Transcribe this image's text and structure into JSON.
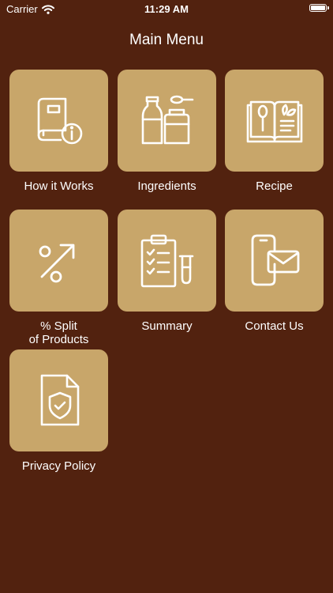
{
  "status_bar": {
    "carrier": "Carrier",
    "time": "11:29 AM"
  },
  "header": {
    "title": "Main Menu"
  },
  "menu": {
    "items": [
      {
        "label": "How it Works",
        "icon": "book-info-icon"
      },
      {
        "label": "Ingredients",
        "icon": "bottles-icon"
      },
      {
        "label": "Recipe",
        "icon": "recipe-book-icon"
      },
      {
        "label": "% Split\nof Products",
        "icon": "percent-arrow-icon"
      },
      {
        "label": "Summary",
        "icon": "clipboard-checklist-icon"
      },
      {
        "label": "Contact Us",
        "icon": "phone-mail-icon"
      },
      {
        "label": "Privacy Policy",
        "icon": "document-shield-icon"
      }
    ]
  },
  "colors": {
    "background": "#52220f",
    "tile": "#c8a66a",
    "text": "#ffffff"
  }
}
